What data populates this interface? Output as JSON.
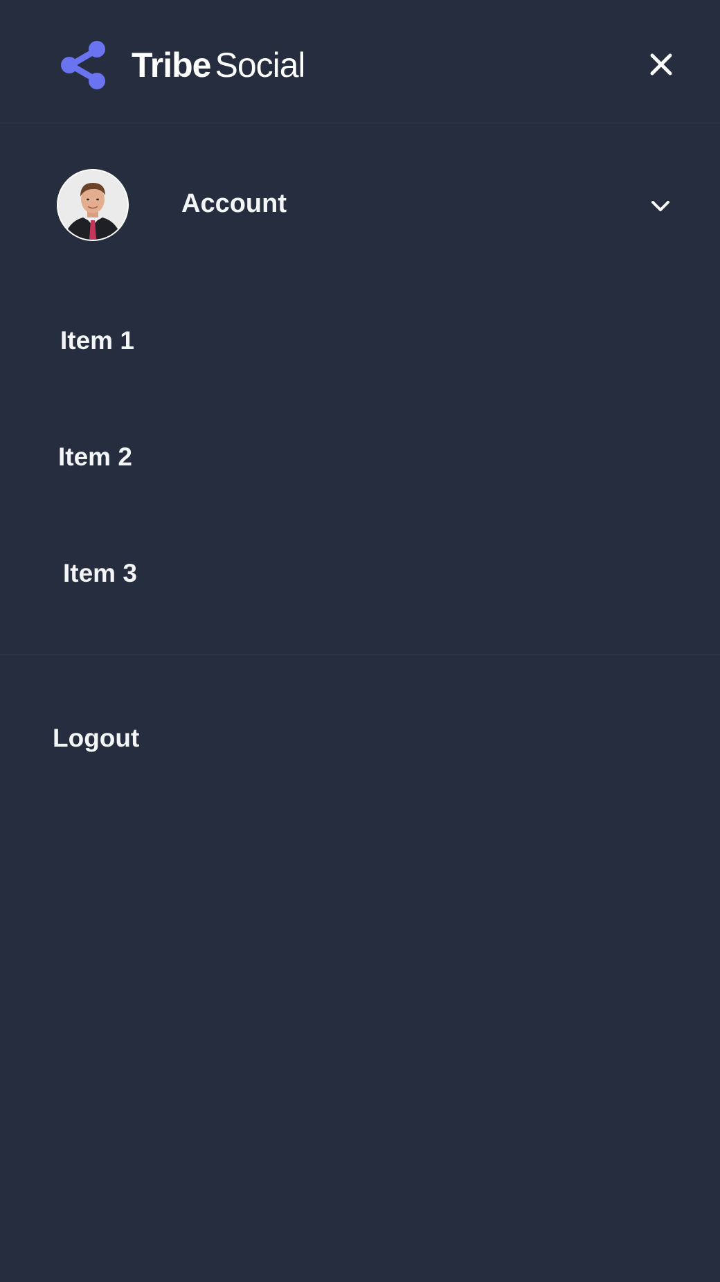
{
  "brand": {
    "name_bold": "Tribe",
    "name_light": "Social",
    "accent_color": "#6a74f0",
    "logo_icon": "share-icon"
  },
  "header": {
    "close_icon": "close-icon"
  },
  "account": {
    "label": "Account",
    "avatar_icon": "avatar",
    "expand_icon": "chevron-down-icon"
  },
  "menu": {
    "items": [
      {
        "label": "Item 1"
      },
      {
        "label": "Item 2"
      },
      {
        "label": "Item 3"
      }
    ]
  },
  "footer": {
    "logout_label": "Logout"
  },
  "colors": {
    "background": "#252d3f",
    "divider": "#303a4d",
    "text": "#f4f5f7"
  }
}
